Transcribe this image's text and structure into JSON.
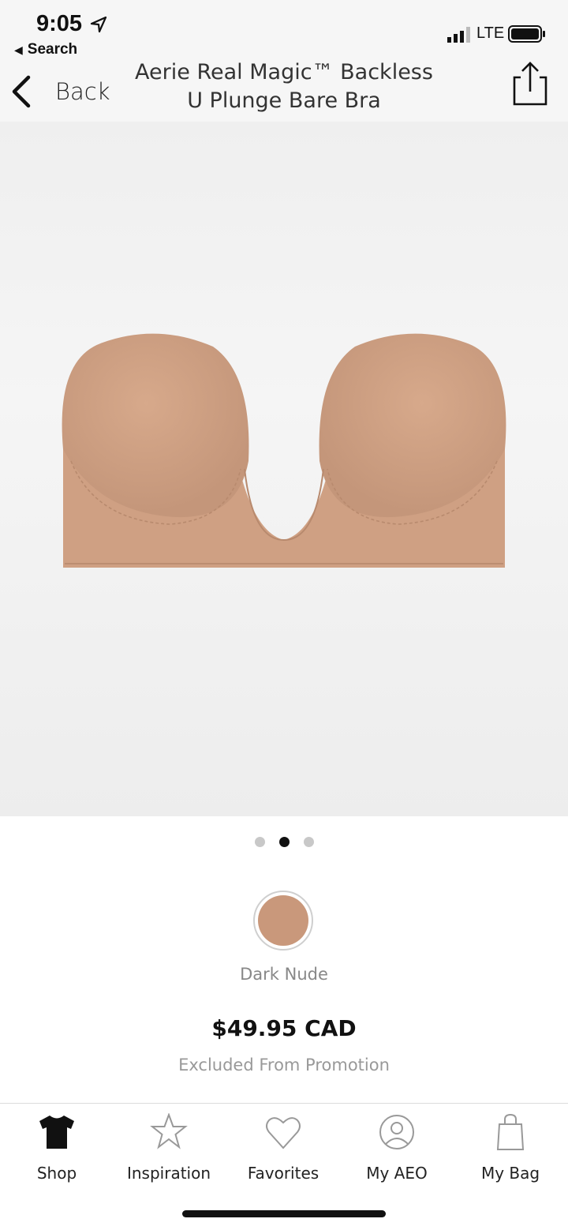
{
  "status_bar": {
    "time": "9:05",
    "back_to_app": "Search",
    "network": "LTE"
  },
  "nav": {
    "back_label": "Back",
    "title": "Aerie Real Magic™ Backless U Plunge Bare Bra"
  },
  "carousel": {
    "total": 3,
    "active_index": 1
  },
  "product": {
    "color_name": "Dark Nude",
    "swatch_color": "#c9987b",
    "price": "$49.95 CAD",
    "promo_note": "Excluded From Promotion"
  },
  "tabs": [
    {
      "label": "Shop",
      "icon": "tshirt-icon"
    },
    {
      "label": "Inspiration",
      "icon": "star-icon"
    },
    {
      "label": "Favorites",
      "icon": "heart-icon"
    },
    {
      "label": "My AEO",
      "icon": "user-icon"
    },
    {
      "label": "My Bag",
      "icon": "bag-icon"
    }
  ]
}
